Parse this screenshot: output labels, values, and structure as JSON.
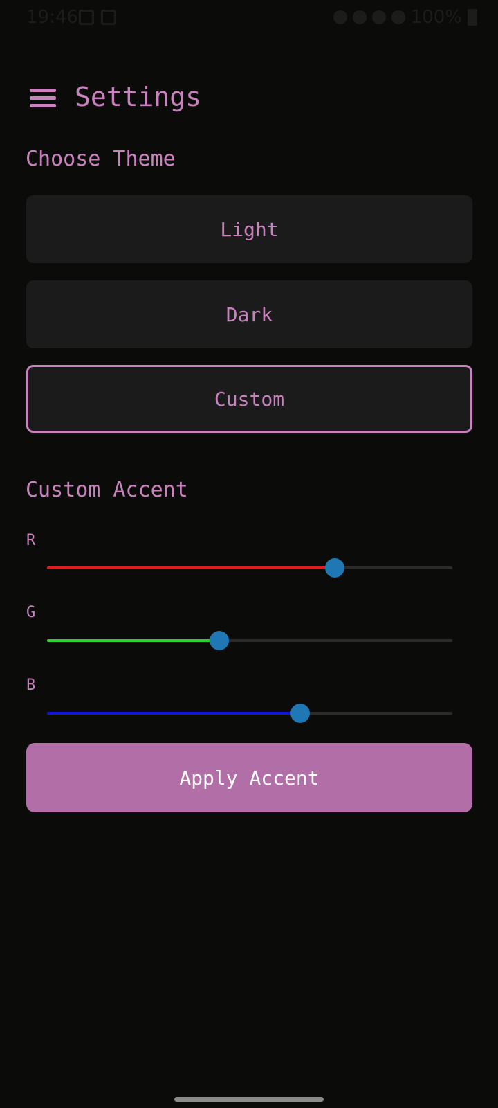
{
  "status_bar": {
    "time": "19:46",
    "battery": "100%"
  },
  "header": {
    "menu_icon": "hamburger-menu-icon",
    "title": "Settings"
  },
  "theme_section": {
    "label": "Choose Theme",
    "options": [
      {
        "label": "Light",
        "selected": false
      },
      {
        "label": "Dark",
        "selected": false
      },
      {
        "label": "Custom",
        "selected": true
      }
    ]
  },
  "accent_section": {
    "label": "Custom Accent",
    "sliders": [
      {
        "label": "R",
        "value": 0.71,
        "color": "#e01c1c"
      },
      {
        "label": "G",
        "value": 0.425,
        "color": "#2bd12b"
      },
      {
        "label": "B",
        "value": 0.625,
        "color": "#1414e0"
      }
    ],
    "thumb_color": "#1f77b4",
    "apply_label": "Apply Accent"
  },
  "colors": {
    "background": "#0b0b09",
    "accent": "#c882be",
    "button": "#b26ea6",
    "card": "#1b1b1b"
  }
}
